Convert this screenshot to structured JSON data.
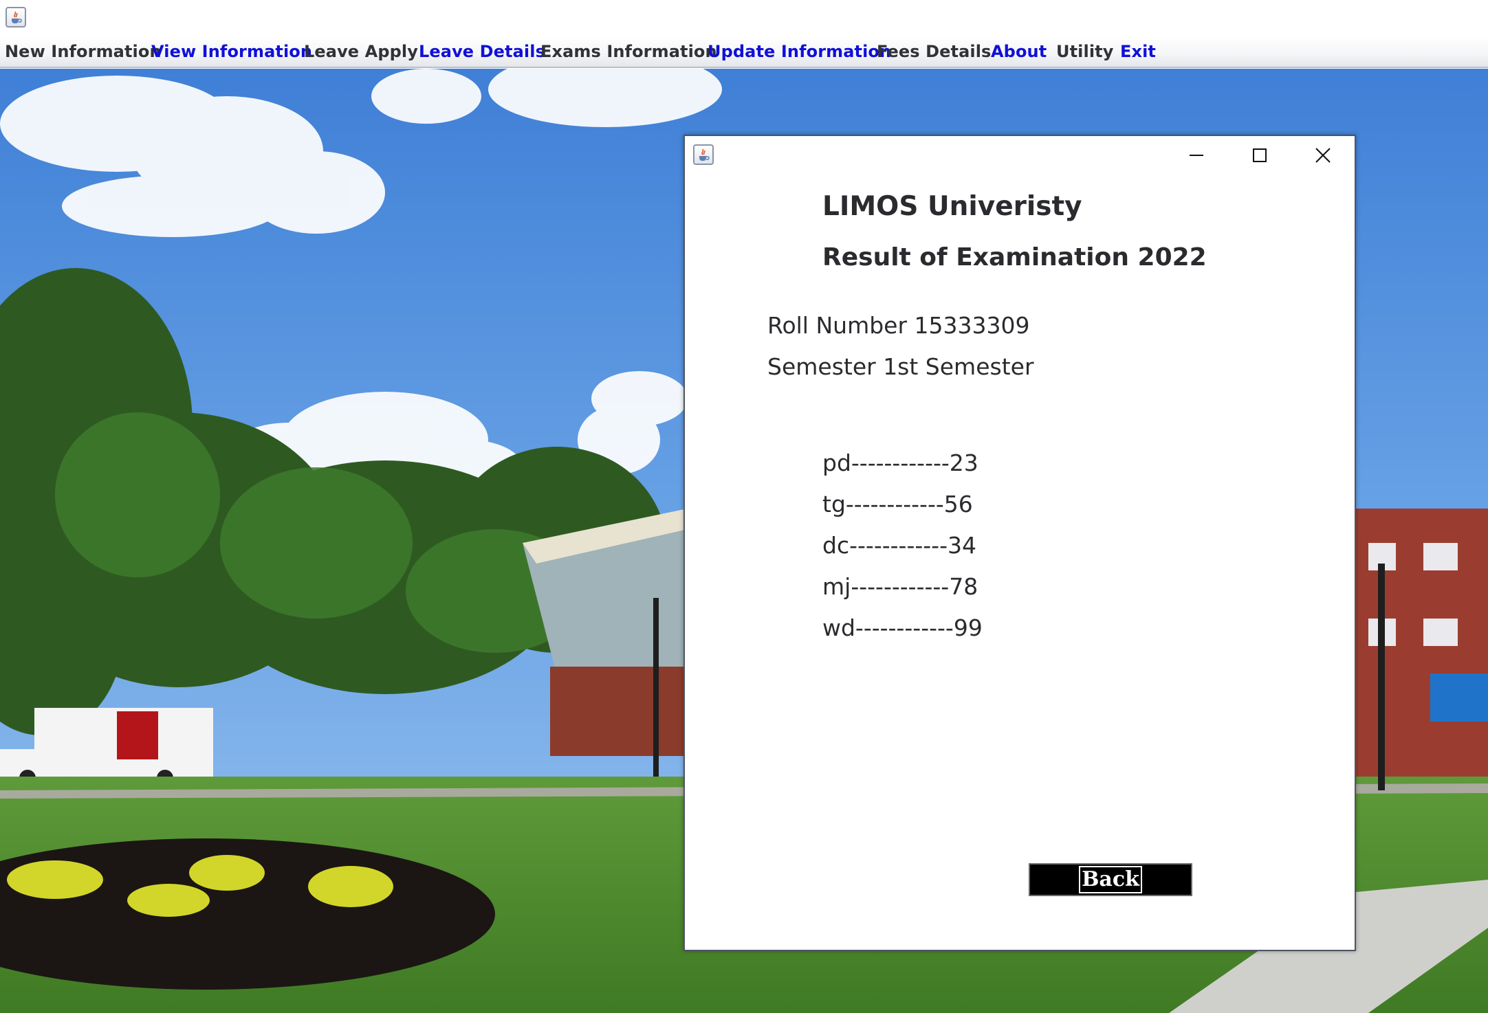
{
  "main_window": {
    "icon": "java-cup-icon"
  },
  "menu": {
    "items": [
      {
        "label": "New Information",
        "color": "#303236"
      },
      {
        "label": "View Information",
        "color": "#1010d8"
      },
      {
        "label": "Leave Apply",
        "color": "#303236"
      },
      {
        "label": "Leave Details",
        "color": "#1010d8"
      },
      {
        "label": "Exams Information",
        "color": "#303236"
      },
      {
        "label": "Update Information",
        "color": "#1010d8"
      },
      {
        "label": "Fees Details",
        "color": "#303236"
      },
      {
        "label": "About",
        "color": "#1010d8"
      },
      {
        "label": "Utility",
        "color": "#303236"
      },
      {
        "label": "Exit",
        "color": "#1010d8"
      }
    ]
  },
  "dialog": {
    "icon": "java-cup-icon",
    "controls": [
      "minimize-icon",
      "maximize-icon",
      "close-icon"
    ],
    "university": "LIMOS Univeristy",
    "heading": "Result of Examination 2022",
    "roll_number": "Roll Number 15333309",
    "semester": "Semester 1st Semester",
    "marks": [
      "pd------------23",
      "tg------------56",
      "dc------------34",
      "mj------------78",
      "wd------------99"
    ],
    "back_label": "Back"
  }
}
